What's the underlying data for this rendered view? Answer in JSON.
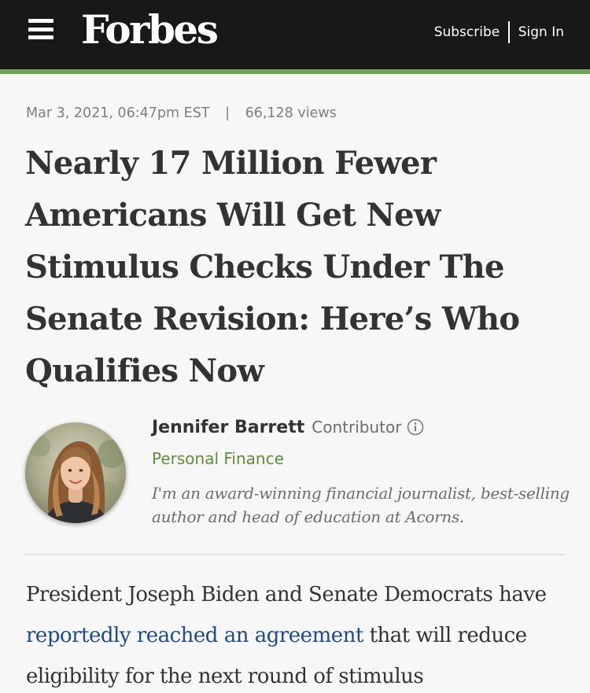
{
  "header": {
    "logo": "Forbes",
    "subscribe_label": "Subscribe",
    "sign_in_label": "Sign In",
    "background": "#181818",
    "accent_color": "#6e9f53"
  },
  "article": {
    "date": "Mar 3, 2021, 06:47pm EST",
    "separator": "|",
    "views": "66,128 views",
    "headline": "Nearly 17 Million Fewer Americans Will Get New Stimulus Checks Under The Senate Revision: Here’s Who Qualifies Now",
    "author": {
      "name": "Jennifer Barrett",
      "role": "Contributor",
      "channel": "Personal Finance",
      "bio": "I'm an award-winning financial journalist, best-selling author and head of education at Acorns."
    },
    "body": {
      "before_link": "President Joseph Biden and Senate Democrats have ",
      "link_text": "reportedly reached an agreement",
      "after_link": " that will reduce eligibility for the next round of stimulus"
    }
  },
  "icons": {
    "menu": "hamburger-menu-icon",
    "info": "info-circle-icon",
    "avatar": "author-avatar-photo"
  },
  "colors": {
    "channel": "#5f8d3e",
    "link": "#1e4b8c",
    "text": "#333333"
  }
}
